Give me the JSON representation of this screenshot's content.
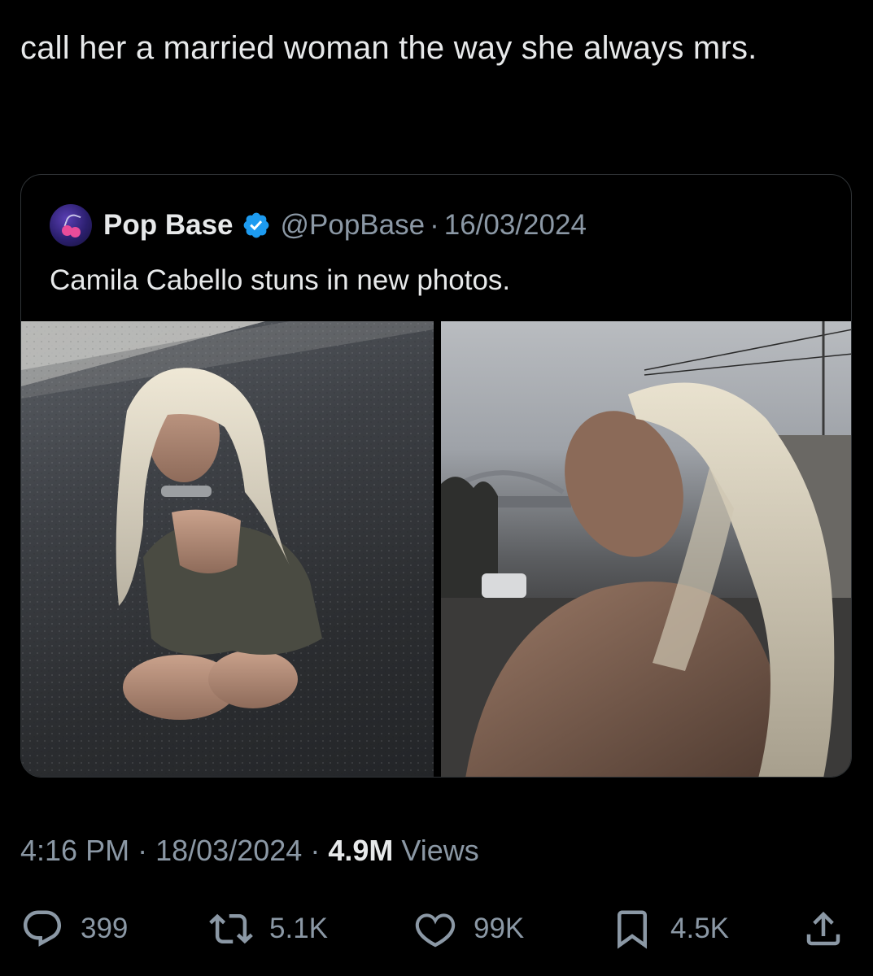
{
  "post": {
    "text": "call her a married woman the way she always mrs.",
    "time": "4:16 PM",
    "date": "18/03/2024",
    "views_count": "4.9M",
    "views_label": "Views",
    "separator": "·"
  },
  "quoted": {
    "author_name": "Pop Base",
    "handle": "@PopBase",
    "separator": "·",
    "date": "16/03/2024",
    "text": "Camila Cabello stuns in new photos.",
    "avatar_icon": "cherry-logo-icon",
    "verified_icon": "verified-badge-icon",
    "verified_color": "#1d9bf0"
  },
  "actions": {
    "replies": "399",
    "reposts": "5.1K",
    "likes": "99K",
    "bookmarks": "4.5K"
  },
  "colors": {
    "background": "#000000",
    "text_primary": "#e7e9ea",
    "text_secondary": "#8b98a5",
    "border": "#2f3336"
  }
}
